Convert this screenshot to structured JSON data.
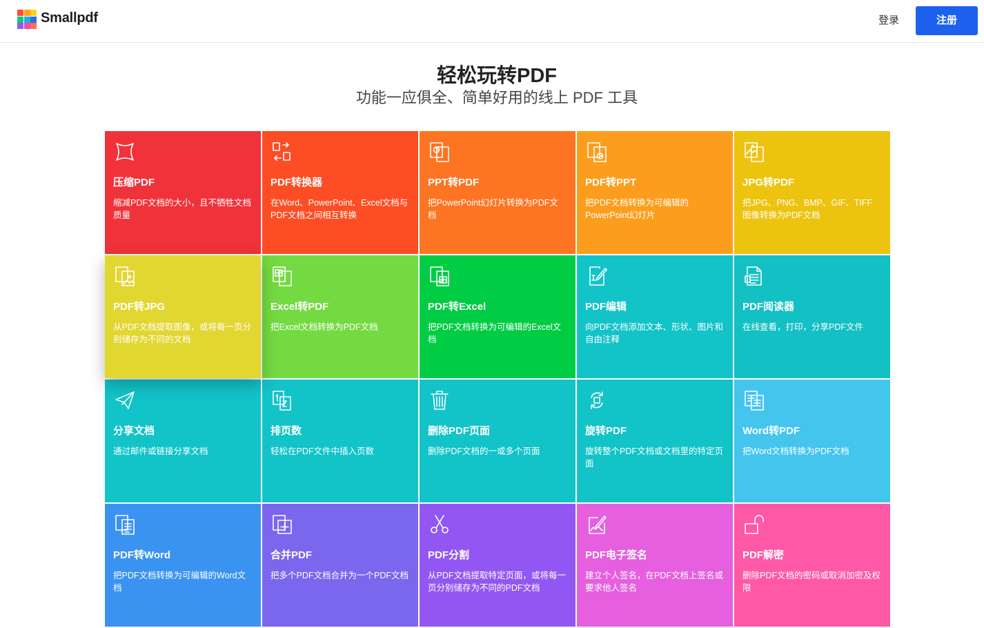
{
  "header": {
    "brand": "Smallpdf",
    "login_label": "登录",
    "signup_label": "注册",
    "logo_colors": [
      "#ff4d3f",
      "#ffa31a",
      "#ffd11a",
      "#18c37b",
      "#1ab2e6",
      "#2d6cf0",
      "#8b5cf6",
      "#f24ca5",
      "#ff6b57"
    ],
    "signup_color": "#1d62ee"
  },
  "hero": {
    "title": "轻松玩转PDF",
    "subtitle": "功能一应俱全、简单好用的线上 PDF 工具"
  },
  "tools": [
    {
      "title": "压缩PDF",
      "desc": "缩减PDF文档的大小，且不牺牲文档质量",
      "color": "#f0323a",
      "icon": "compress-icon"
    },
    {
      "title": "PDF转换器",
      "desc": "在Word、PowerPoint、Excel文档与PDF文档之间相互转换",
      "color": "#fd4d24",
      "icon": "convert-icon"
    },
    {
      "title": "PPT转PDF",
      "desc": "把PowerPoint幻灯片转换为PDF文档",
      "color": "#fd7422",
      "icon": "ppt-icon"
    },
    {
      "title": "PDF转PPT",
      "desc": "把PDF文档转换为可编辑的PowerPoint幻灯片",
      "color": "#fc9d1d",
      "icon": "pdf-ppt-icon"
    },
    {
      "title": "JPG转PDF",
      "desc": "把JPG、PNG、BMP、GIF、TIFF图像转换为PDF文档",
      "color": "#ecc30f",
      "icon": "image-icon"
    },
    {
      "title": "PDF转JPG",
      "desc": "从PDF文档提取图像，或将每一页分别储存为不同的文档",
      "color": "#e2d631",
      "icon": "pdf-image-icon"
    },
    {
      "title": "Excel转PDF",
      "desc": "把Excel文档转换为PDF文档",
      "color": "#74da41",
      "icon": "excel-icon"
    },
    {
      "title": "PDF转Excel",
      "desc": "把PDF文档转换为可编辑的Excel文档",
      "color": "#00cc44",
      "icon": "pdf-excel-icon"
    },
    {
      "title": "PDF编辑",
      "desc": "向PDF文档添加文本、形状、图片和自由注释",
      "color": "#12c3c8",
      "icon": "edit-icon"
    },
    {
      "title": "PDF阅读器",
      "desc": "在线查看，打印，分享PDF文件",
      "color": "#13c0c4",
      "icon": "reader-icon"
    },
    {
      "title": "分享文档",
      "desc": "通过邮件或链接分享文档",
      "color": "#12c3c8",
      "icon": "share-icon"
    },
    {
      "title": "排页数",
      "desc": "轻松在PDF文件中插入页数",
      "color": "#12c3c8",
      "icon": "page-numbers-icon"
    },
    {
      "title": "删除PDF页面",
      "desc": "删除PDF文档的一或多个页面",
      "color": "#12c3c8",
      "icon": "trash-icon"
    },
    {
      "title": "旋转PDF",
      "desc": "旋转整个PDF文档或文档里的特定页面",
      "color": "#12c3c8",
      "icon": "rotate-icon"
    },
    {
      "title": "Word转PDF",
      "desc": "把Word文档转换为PDF文档",
      "color": "#44c5ee",
      "icon": "word-icon"
    },
    {
      "title": "PDF转Word",
      "desc": "把PDF文档转换为可编辑的Word文档",
      "color": "#3a93f1",
      "icon": "pdf-word-icon"
    },
    {
      "title": "合并PDF",
      "desc": "把多个PDF文档合并为一个PDF文档",
      "color": "#7b66ee",
      "icon": "merge-icon"
    },
    {
      "title": "PDF分割",
      "desc": "从PDF文档提取特定页面，或将每一页分别储存为不同的PDF文档",
      "color": "#9257f2",
      "icon": "scissors-icon"
    },
    {
      "title": "PDF电子签名",
      "desc": "建立个人签名，在PDF文档上签名或要求他人签名",
      "color": "#e55fdf",
      "icon": "sign-icon"
    },
    {
      "title": "PDF解密",
      "desc": "删除PDF文档的密码或取消加密及权限",
      "color": "#fe58a7",
      "icon": "unlock-icon"
    }
  ]
}
